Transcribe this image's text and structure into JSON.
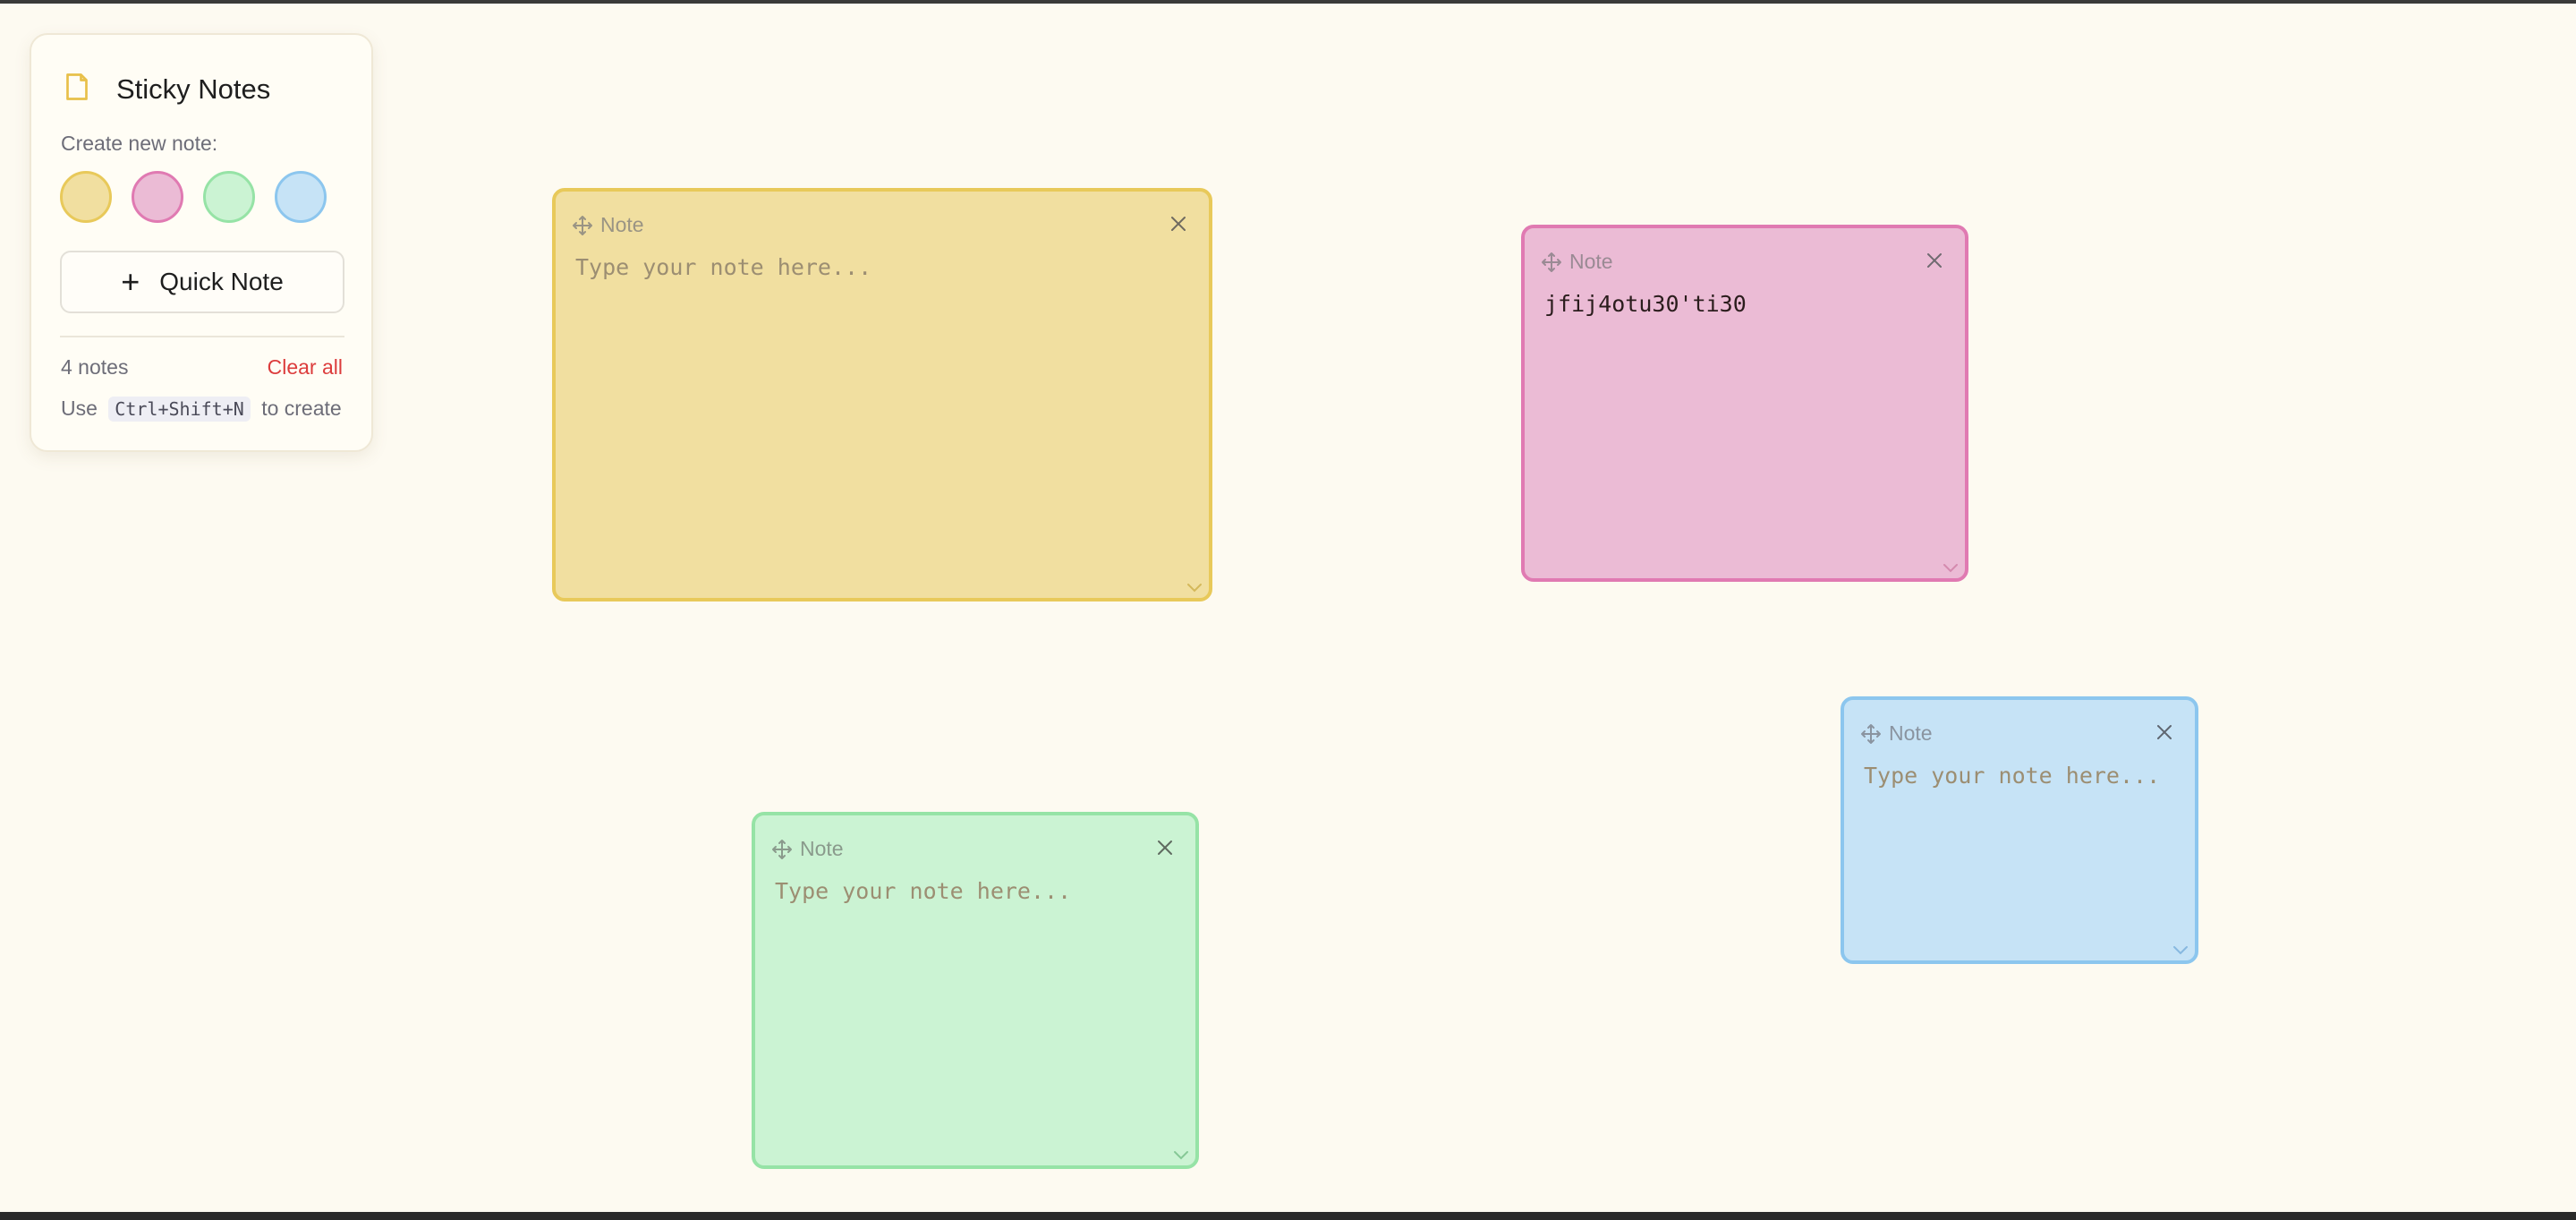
{
  "app": {
    "title": "Sticky Notes",
    "icon": "note-icon"
  },
  "panel": {
    "create_label": "Create new note:",
    "swatches": [
      {
        "name": "yellow",
        "fill": "#f1dfa0",
        "border": "#e8c95a"
      },
      {
        "name": "pink",
        "fill": "#ebbbd5",
        "border": "#e07ab2"
      },
      {
        "name": "green",
        "fill": "#cbf3d3",
        "border": "#96e3a6"
      },
      {
        "name": "blue",
        "fill": "#c6e3f6",
        "border": "#8cc6ee"
      }
    ],
    "quick_note_label": "Quick Note",
    "quick_note_icon": "plus-icon",
    "count_label": "4 notes",
    "clear_label": "Clear all",
    "hint_prefix": "Use",
    "hint_shortcut": "Ctrl+Shift+N",
    "hint_suffix": "to create"
  },
  "notes": [
    {
      "color": "yellow",
      "header": "Note",
      "value": "",
      "placeholder": "Type your note here..."
    },
    {
      "color": "pink",
      "header": "Note",
      "value": "jfij4otu30'ti30",
      "placeholder": "Type your note here..."
    },
    {
      "color": "green",
      "header": "Note",
      "value": "",
      "placeholder": "Type your note here..."
    },
    {
      "color": "blue",
      "header": "Note",
      "value": "",
      "placeholder": "Type your note here..."
    }
  ],
  "colors": {
    "background": "#fdfaf1",
    "danger": "#dc3c3c",
    "accent": "#e8c95a"
  }
}
